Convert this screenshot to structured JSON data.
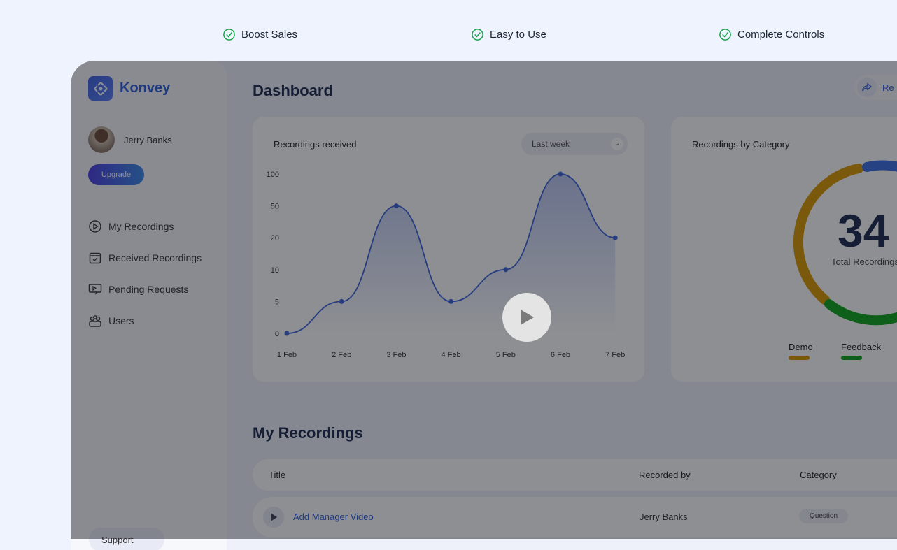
{
  "features": [
    "Boost Sales",
    "Easy to Use",
    "Complete Controls"
  ],
  "brand": "Konvey",
  "user": {
    "name": "Jerry Banks",
    "upgrade": "Upgrade"
  },
  "nav": [
    "My Recordings",
    "Received Recordings",
    "Pending Requests",
    "Users"
  ],
  "support": "Support",
  "header": {
    "title": "Dashboard",
    "share_label": "Re"
  },
  "chart_card": {
    "title": "Recordings received",
    "range": "Last week"
  },
  "chart_data": {
    "type": "line",
    "title": "Recordings received",
    "x": [
      "1 Feb",
      "2 Feb",
      "3 Feb",
      "4 Feb",
      "5 Feb",
      "6 Feb",
      "7 Feb"
    ],
    "y_ticks": [
      0,
      5,
      10,
      20,
      50,
      100
    ],
    "values": [
      0,
      5,
      50,
      5,
      10,
      100,
      20
    ],
    "color": "#3b63d8",
    "area_fill": true
  },
  "category_card": {
    "title": "Recordings by Category",
    "total": "34",
    "total_label": "Total Recordings",
    "legend": [
      {
        "name": "Demo",
        "color": "#d99a00"
      },
      {
        "name": "Feedback",
        "color": "#0fa51a"
      }
    ],
    "extra_color": "#3b6fe0"
  },
  "recordings": {
    "title": "My Recordings",
    "columns": [
      "Title",
      "Recorded by",
      "Category"
    ],
    "rows": [
      {
        "title": "Add Manager Video",
        "by": "Jerry Banks",
        "category": "Question"
      }
    ]
  }
}
